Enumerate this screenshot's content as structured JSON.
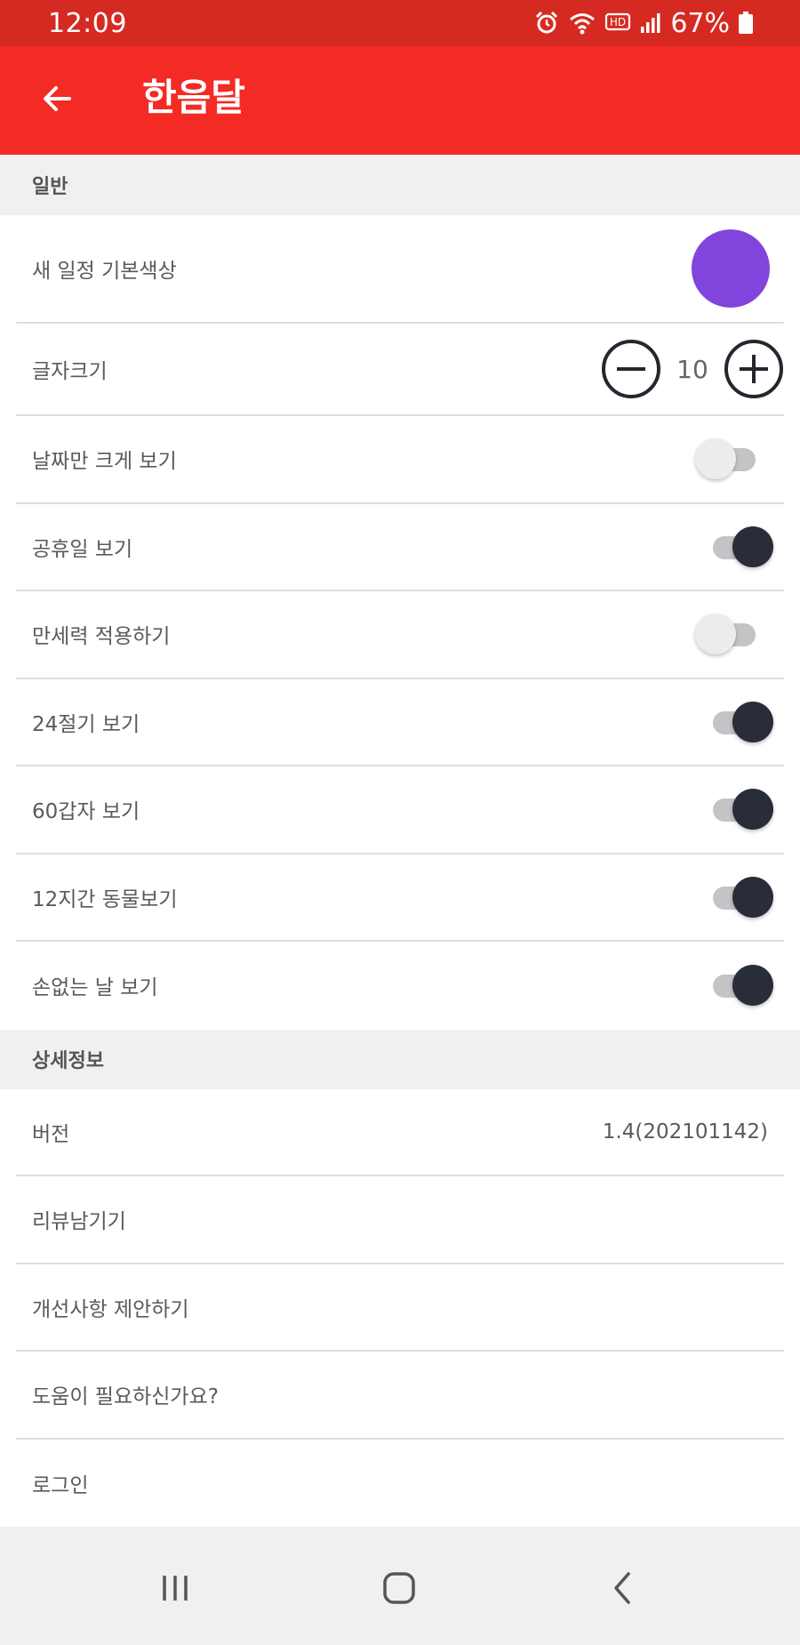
{
  "status_bar": {
    "time": "12:09",
    "battery_percent": "67%",
    "icons": [
      "alarm-icon",
      "wifi-icon",
      "hd-icon",
      "signal-icon",
      "battery-icon"
    ]
  },
  "app_bar": {
    "title": "한음달",
    "back_icon": "arrow-left-icon",
    "color": "#f42a24"
  },
  "sections": {
    "general": {
      "header": "일반",
      "default_color_label": "새 일정 기본색상",
      "default_color": "#8145dd",
      "font_size_label": "글자크기",
      "font_size_value": "10",
      "toggles": [
        {
          "label": "날짜만 크게 보기",
          "on": false
        },
        {
          "label": "공휴일 보기",
          "on": true
        },
        {
          "label": "만세력 적용하기",
          "on": false
        },
        {
          "label": "24절기 보기",
          "on": true
        },
        {
          "label": "60갑자 보기",
          "on": true
        },
        {
          "label": "12지간 동물보기",
          "on": true
        },
        {
          "label": "손없는 날 보기",
          "on": true
        }
      ]
    },
    "details": {
      "header": "상세정보",
      "version_label": "버전",
      "version_value": "1.4(202101142)",
      "items": [
        "리뷰남기기",
        "개선사항 제안하기",
        "도움이 필요하신가요?",
        "로그인"
      ]
    }
  },
  "nav_bar": {
    "buttons": [
      "recent-apps-icon",
      "home-icon",
      "back-icon"
    ]
  }
}
